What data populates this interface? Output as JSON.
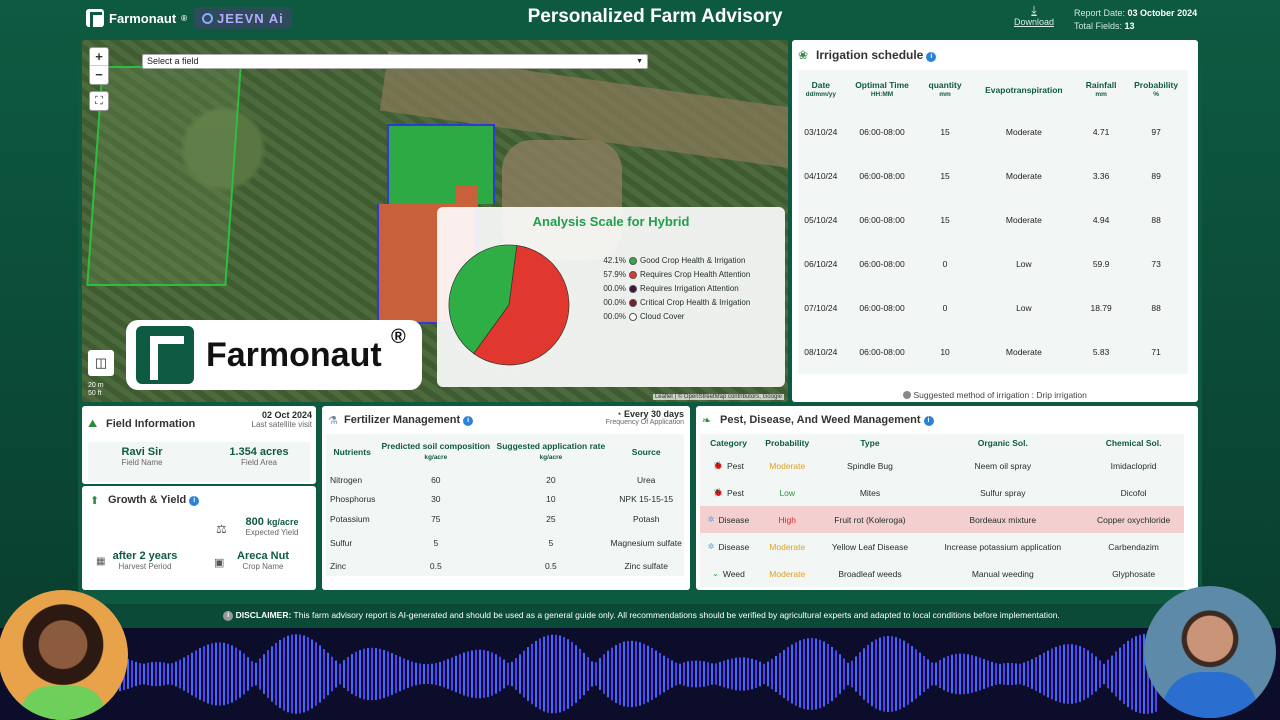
{
  "header": {
    "brand": "Farmonaut",
    "brand_reg": "®",
    "partner": "JEEVN Ai",
    "title": "Personalized Farm Advisory",
    "download_label": "Download",
    "report_date_label": "Report Date:",
    "report_date": "03 October 2024",
    "total_fields_label": "Total Fields:",
    "total_fields": "13"
  },
  "map": {
    "select_placeholder": "Select a field",
    "zoom_in": "+",
    "zoom_out": "−",
    "scale_m": "20 m",
    "scale_ft": "50 ft",
    "attribution": "Leaflet | © OpenStreetMap contributors, Google"
  },
  "logo_overlay": {
    "text": "Farmonaut",
    "reg": "®"
  },
  "analysis": {
    "title": "Analysis Scale for Hybrid",
    "legend": [
      {
        "pct": "42.1%",
        "label": "Good Crop Health & Irrigation",
        "color": "#2fae45"
      },
      {
        "pct": "57.9%",
        "label": "Requires Crop Health Attention",
        "color": "#e0382e"
      },
      {
        "pct": "00.0%",
        "label": "Requires Irrigation Attention",
        "color": "#3a1640"
      },
      {
        "pct": "00.0%",
        "label": "Critical Crop Health & Irrigation",
        "color": "#7a1f2a"
      },
      {
        "pct": "00.0%",
        "label": "Cloud Cover",
        "color": "#ffffff"
      }
    ]
  },
  "chart_data": {
    "type": "pie",
    "title": "Analysis Scale for Hybrid",
    "categories": [
      "Good Crop Health & Irrigation",
      "Requires Crop Health Attention",
      "Requires Irrigation Attention",
      "Critical Crop Health & Irrigation",
      "Cloud Cover"
    ],
    "values": [
      42.1,
      57.9,
      0.0,
      0.0,
      0.0
    ],
    "colors": [
      "#2fae45",
      "#e0382e",
      "#3a1640",
      "#7a1f2a",
      "#ffffff"
    ]
  },
  "irrigation": {
    "title": "Irrigation schedule",
    "headers": [
      {
        "label": "Date",
        "unit": "dd/mm/yy"
      },
      {
        "label": "Optimal Time",
        "unit": "HH:MM"
      },
      {
        "label": "quantity",
        "unit": "mm"
      },
      {
        "label": "Evapotranspiration",
        "unit": ""
      },
      {
        "label": "Rainfall",
        "unit": "mm"
      },
      {
        "label": "Probability",
        "unit": "%"
      }
    ],
    "rows": [
      [
        "03/10/24",
        "06:00-08:00",
        "15",
        "Moderate",
        "4.71",
        "97"
      ],
      [
        "04/10/24",
        "06:00-08:00",
        "15",
        "Moderate",
        "3.36",
        "89"
      ],
      [
        "05/10/24",
        "06:00-08:00",
        "15",
        "Moderate",
        "4.94",
        "88"
      ],
      [
        "06/10/24",
        "06:00-08:00",
        "0",
        "Low",
        "59.9",
        "73"
      ],
      [
        "07/10/24",
        "06:00-08:00",
        "0",
        "Low",
        "18.79",
        "88"
      ],
      [
        "08/10/24",
        "06:00-08:00",
        "10",
        "Moderate",
        "5.83",
        "71"
      ]
    ],
    "suggestion": "Suggested method of irrigation : Drip irrigation"
  },
  "field_info": {
    "title": "Field Information",
    "date": "02 Oct 2024",
    "date_caption": "Last satellite visit",
    "name": "Ravi Sir",
    "name_caption": "Field Name",
    "area": "1.354 acres",
    "area_caption": "Field Area"
  },
  "growth": {
    "title": "Growth & Yield",
    "yield": "800",
    "yield_unit": "kg/acre",
    "yield_caption": "Expected Yield",
    "harvest": "after 2 years",
    "harvest_caption": "Harvest Period",
    "crop": "Areca Nut",
    "crop_caption": "Crop Name"
  },
  "fertilizer": {
    "title": "Fertilizer Management",
    "freq": "Every 30 days",
    "freq_caption": "Frequency Of Application",
    "headers": [
      {
        "label": "Nutrients",
        "unit": ""
      },
      {
        "label": "Predicted soil composition",
        "unit": "kg/acre"
      },
      {
        "label": "Suggested application rate",
        "unit": "kg/acre"
      },
      {
        "label": "Source",
        "unit": ""
      }
    ],
    "rows": [
      [
        "Nitrogen",
        "60",
        "20",
        "Urea"
      ],
      [
        "Phosphorus",
        "30",
        "10",
        "NPK 15-15-15"
      ],
      [
        "Potassium",
        "75",
        "25",
        "Potash"
      ],
      [
        "Sulfur",
        "5",
        "5",
        "Magnesium sulfate"
      ],
      [
        "Zinc",
        "0.5",
        "0.5",
        "Zinc sulfate"
      ]
    ]
  },
  "pest": {
    "title": "Pest, Disease, And Weed Management",
    "headers": [
      "Category",
      "Probability",
      "Type",
      "Organic Sol.",
      "Chemical Sol."
    ],
    "rows": [
      {
        "icon": "bug-icon",
        "category": "Pest",
        "probability": "Moderate",
        "type": "Spindle Bug",
        "organic": "Neem oil spray",
        "chemical": "Imidacloprid"
      },
      {
        "icon": "bug-icon",
        "category": "Pest",
        "probability": "Low",
        "type": "Mites",
        "organic": "Sulfur spray",
        "chemical": "Dicofol"
      },
      {
        "icon": "virus-icon",
        "category": "Disease",
        "probability": "High",
        "type": "Fruit rot (Koleroga)",
        "organic": "Bordeaux mixture",
        "chemical": "Copper oxychloride"
      },
      {
        "icon": "virus-icon",
        "category": "Disease",
        "probability": "Moderate",
        "type": "Yellow Leaf Disease",
        "organic": "Increase potassium application",
        "chemical": "Carbendazim"
      },
      {
        "icon": "weed-icon",
        "category": "Weed",
        "probability": "Moderate",
        "type": "Broadleaf weeds",
        "organic": "Manual weeding",
        "chemical": "Glyphosate"
      }
    ]
  },
  "disclaimer": {
    "label": "DISCLAIMER:",
    "text": "This farm advisory report is AI-generated and should be used as a general guide only. All recommendations should be verified by agricultural experts and adapted to local conditions before implementation."
  },
  "colors": {
    "brand": "#0d5a41",
    "moderate": "#e0a21a",
    "low": "#2c9a3c",
    "high": "#d62c2c"
  }
}
